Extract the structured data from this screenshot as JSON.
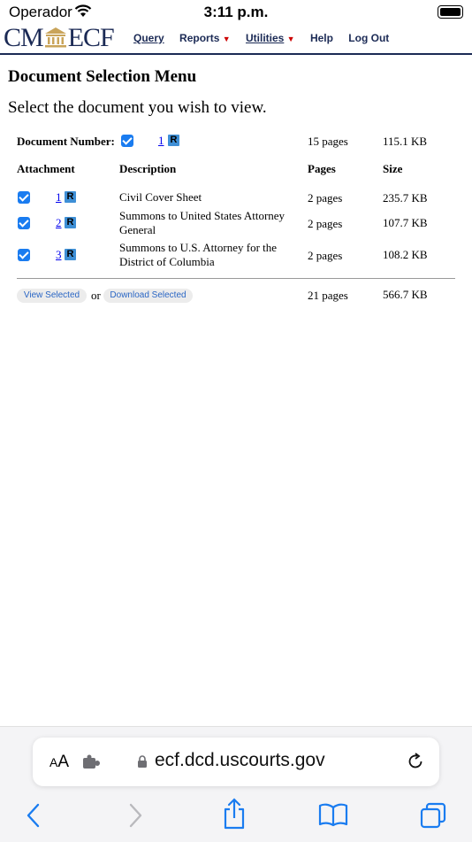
{
  "status": {
    "carrier": "Operador",
    "time": "3:11 p.m."
  },
  "header": {
    "logo_left": "CM",
    "logo_right": "ECF",
    "menu": [
      "Query",
      "Reports",
      "Utilities",
      "Help",
      "Log Out"
    ]
  },
  "page": {
    "title": "Document Selection Menu",
    "subtitle": "Select the document you wish to view."
  },
  "main_doc": {
    "label": "Document Number:",
    "number": "1",
    "pages": "15 pages",
    "size": "115.1 KB"
  },
  "table": {
    "headers": [
      "Attachment",
      "Description",
      "Pages",
      "Size"
    ],
    "rows": [
      {
        "num": "1",
        "desc1": "Civil Cover Sheet",
        "desc2": "",
        "pages": "2 pages",
        "size": "235.7 KB"
      },
      {
        "num": "2",
        "desc1": "Summons to United States Attorney",
        "desc2": "General",
        "pages": "2 pages",
        "size": "107.7 KB"
      },
      {
        "num": "3",
        "desc1": "Summons to U.S. Attorney for the",
        "desc2": "District of Columbia",
        "pages": "2 pages",
        "size": "108.2 KB"
      }
    ]
  },
  "footer": {
    "view_selected": "View Selected",
    "or": "or",
    "download_selected": "Download Selected",
    "total_pages": "21 pages",
    "total_size": "566.7 KB"
  },
  "badge_letter": "R",
  "safari": {
    "aa": "AA",
    "url": "ecf.dcd.uscourts.gov"
  },
  "colors": {
    "brand": "#1b2a55",
    "checkbox": "#1a7cf0",
    "badge": "#3e8fd6",
    "link": "#0000ee"
  }
}
